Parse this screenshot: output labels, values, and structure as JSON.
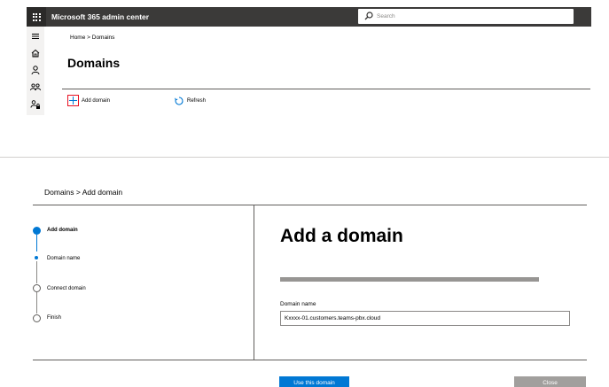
{
  "header": {
    "app_title": "Microsoft 365 admin center",
    "search_placeholder": "Search"
  },
  "left_nav": {
    "icons": [
      "hamburger-icon",
      "home-icon",
      "user-icon",
      "group-icon",
      "user-lock-icon"
    ]
  },
  "top_page": {
    "breadcrumb": "Home > Domains",
    "title": "Domains",
    "commands": {
      "add_label": "Add domain",
      "refresh_label": "Refresh"
    }
  },
  "wizard": {
    "breadcrumb": "Domains > Add domain",
    "steps": [
      {
        "label": "Add domain",
        "state": "current"
      },
      {
        "label": "Domain name",
        "state": "current-sub"
      },
      {
        "label": "Connect domain",
        "state": "pending"
      },
      {
        "label": "Finish",
        "state": "pending"
      }
    ],
    "title": "Add a domain",
    "field_label": "Domain name",
    "field_value": "Kxxxx-01.customers.teams-pbx.cloud",
    "primary_button": "Use this domain",
    "secondary_button": "Close"
  },
  "colors": {
    "accent": "#0078d4",
    "topbar": "#3b3a39",
    "highlight": "#e81123",
    "disabled_button": "#a19f9d"
  }
}
